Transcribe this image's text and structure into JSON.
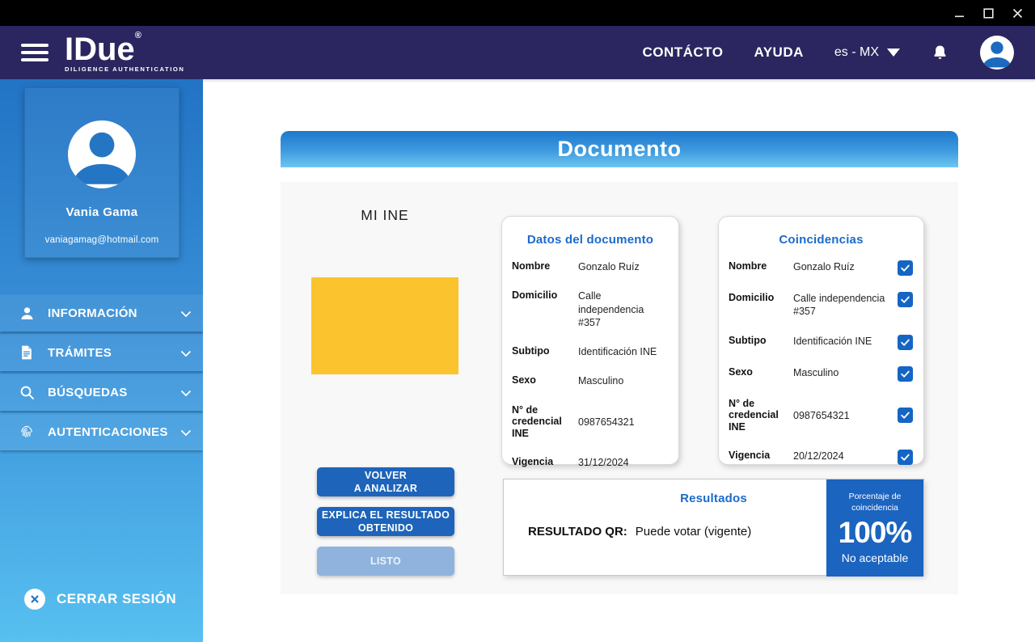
{
  "window": {
    "controls": [
      "minimize-icon",
      "maximize-icon",
      "close-icon"
    ]
  },
  "header": {
    "logo": {
      "title": "IDue",
      "registered": "®",
      "tagline": "DILIGENCE AUTHENTICATION"
    },
    "nav": [
      {
        "label": "CONTÁCTO"
      },
      {
        "label": "AYUDA"
      }
    ],
    "language": "es - MX",
    "icons": [
      "hamburger-menu-icon",
      "chevron-down-icon",
      "bell-icon",
      "user-avatar-icon"
    ]
  },
  "sidebar": {
    "profile": {
      "name": "Vania Gama",
      "email": "vaniagamag@hotmail.com"
    },
    "menu": [
      {
        "label": "INFORMACIÓN",
        "icon": "person-icon"
      },
      {
        "label": "TRÁMITES",
        "icon": "document-icon"
      },
      {
        "label": "BÚSQUEDAS",
        "icon": "search-icon"
      },
      {
        "label": "AUTENTICACIONES",
        "icon": "fingerprint-icon"
      }
    ],
    "logout_label": "CERRAR SESIÓN",
    "logout_icon": "x-circle-icon"
  },
  "main": {
    "banner_title": "Documento",
    "document_label": "MI INE",
    "cards": {
      "datos": {
        "title": "Datos del documento",
        "rows": [
          {
            "label": "Nombre",
            "value": "Gonzalo Ruíz"
          },
          {
            "label": "Domicilio",
            "value": "Calle independencia #357"
          },
          {
            "label": "Subtipo",
            "value": "Identificación INE"
          },
          {
            "label": "Sexo",
            "value": "Masculino"
          },
          {
            "label": "N° de credencial INE",
            "value": "0987654321"
          },
          {
            "label": "Vigencia",
            "value": "31/12/2024"
          }
        ]
      },
      "coincidencias": {
        "title": "Coincidencias",
        "rows": [
          {
            "label": "Nombre",
            "value": "Gonzalo Ruíz",
            "checked": true
          },
          {
            "label": "Domicilio",
            "value": "Calle independencia #357",
            "checked": true
          },
          {
            "label": "Subtipo",
            "value": "Identificación INE",
            "checked": true
          },
          {
            "label": "Sexo",
            "value": "Masculino",
            "checked": true
          },
          {
            "label": "N° de credencial INE",
            "value": "0987654321",
            "checked": true
          },
          {
            "label": "Vigencia",
            "value": "20/12/2024",
            "checked": true
          }
        ]
      }
    },
    "buttons": {
      "reanalyze": {
        "line1": "VOLVER",
        "line2": "A ANALIZAR"
      },
      "explain": {
        "line1": "EXPLICA EL RESULTADO",
        "line2": "OBTENIDO"
      },
      "done": {
        "label": "LISTO"
      }
    },
    "results": {
      "title": "Resultados",
      "qr_label": "RESULTADO QR:",
      "qr_value": "Puede votar (vigente)",
      "percent_caption": "Porcentaje de coincidencia",
      "percent_value": "100%",
      "percent_status": "No aceptable"
    }
  },
  "colors": {
    "titlebar_bg": "#000000",
    "header_bg": "#2B265F",
    "sidebar_gradient_top": "#2273C4",
    "sidebar_gradient_bottom": "#57C0F0",
    "banner_gradient_top": "#1E78CC",
    "banner_gradient_bottom": "#6FC5F0",
    "accent_title_blue": "#1C6BCB",
    "button_blue": "#1D64BA",
    "button_disabled_blue": "#8FB3DD",
    "checkbox_blue": "#1565C4",
    "percent_box_blue": "#1B64C0",
    "document_placeholder_yellow": "#FBC32D",
    "panel_bg": "#F8F8F8"
  }
}
